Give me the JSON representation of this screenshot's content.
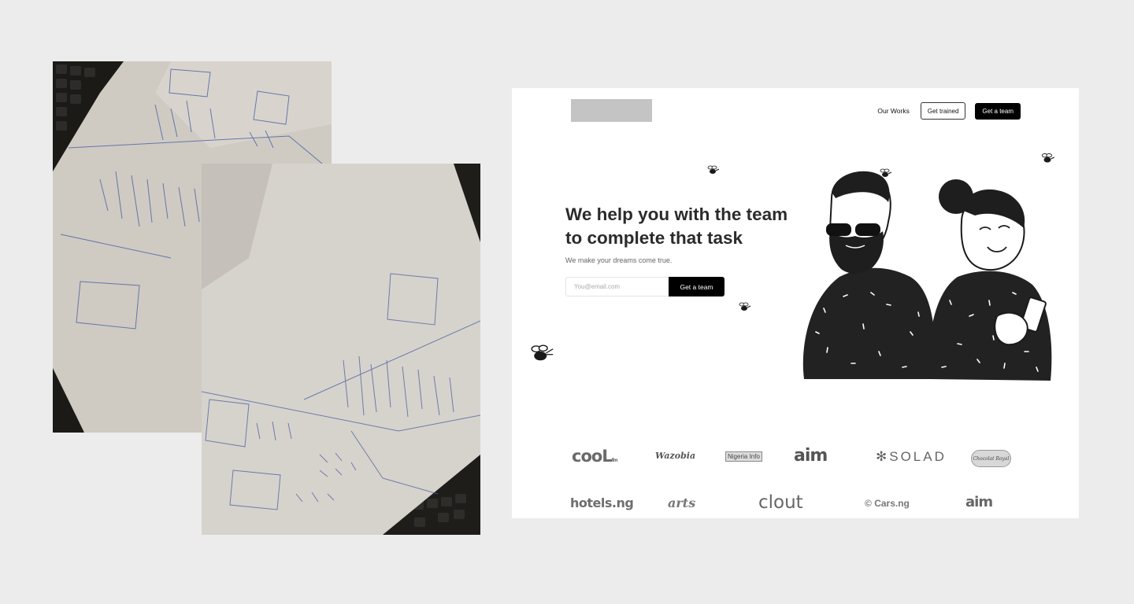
{
  "photos": {
    "back": {
      "description_icon": "paper-sketch-photo-icon"
    },
    "front": {
      "description_icon": "paper-sketch-photo-icon"
    }
  },
  "site": {
    "nav": {
      "our_works": "Our Works",
      "get_trained": "Get trained",
      "get_a_team": "Get a team"
    },
    "hero": {
      "headline_line1": "We help you with the team",
      "headline_line2": "to complete that task",
      "subheadline": "We make your dreams come true.",
      "email_placeholder": "You@email.com",
      "cta": "Get a team"
    },
    "brands_row1": {
      "b1": "cooL",
      "b1_tag": "fm",
      "b2": "Wazobia",
      "b3": "Nigeria Info",
      "b4": "aim",
      "b5": "SOLAD",
      "b6": "Chocolat Royal"
    },
    "brands_row2": {
      "b1": "hotels.ng",
      "b2": "arts",
      "b3": "clout",
      "b4": "Cars.ng",
      "b5": "aim"
    },
    "colors": {
      "background": "#ececec",
      "accent": "#000000",
      "placeholder": "#c4c4c4"
    }
  }
}
